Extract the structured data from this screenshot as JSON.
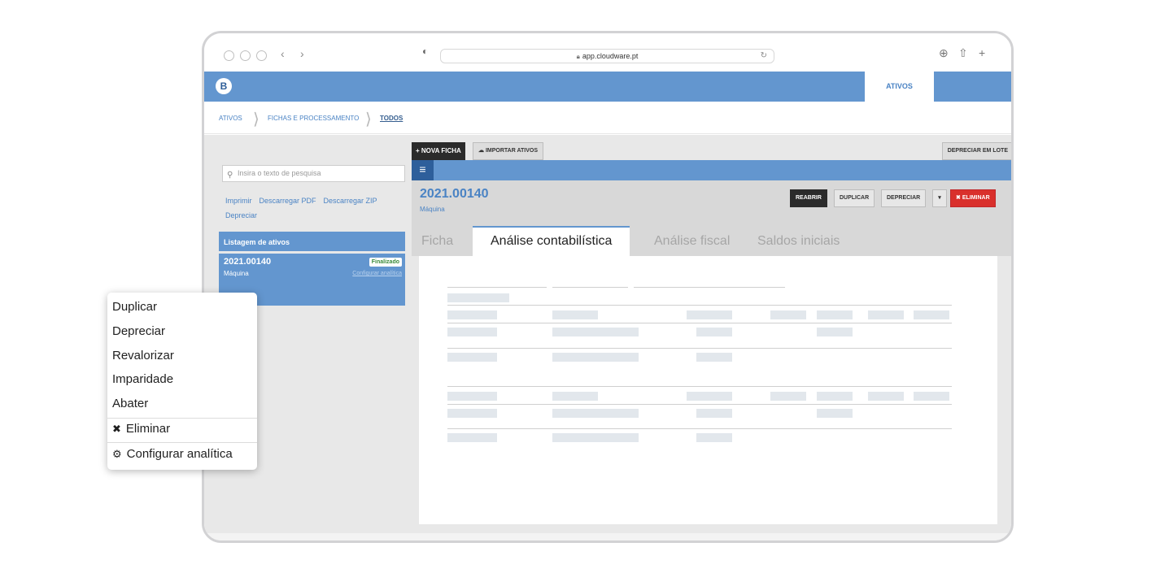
{
  "browser": {
    "url": "app.cloudware.pt"
  },
  "app": {
    "logo_letter": "B",
    "top_tab": "ATIVOS"
  },
  "breadcrumb": [
    "ATIVOS",
    "FICHAS E PROCESSAMENTO",
    "TODOS"
  ],
  "sidebar": {
    "search_placeholder": "Insira o texto de pesquisa",
    "links": [
      "Imprimir",
      "Descarregar PDF",
      "Descarregar ZIP",
      "Depreciar"
    ],
    "list_title": "Listagem de ativos",
    "item": {
      "code": "2021.00140",
      "type": "Máquina",
      "status": "Finalizado",
      "config_link": "Configurar analítica"
    }
  },
  "toolbar": {
    "new_record": "+ NOVA FICHA",
    "import": "IMPORTAR ATIVOS",
    "batch": "DEPRECIAR EM LOTE"
  },
  "record": {
    "code": "2021.00140",
    "type": "Máquina",
    "actions": {
      "reopen": "REABRIR",
      "duplicate": "DUPLICAR",
      "depreciate": "DEPRECIAR",
      "delete": "ELIMINAR"
    }
  },
  "tabs": [
    "Ficha",
    "Análise contabilística",
    "Análise fiscal",
    "Saldos iniciais"
  ],
  "selected_tab": "Análise contabilística",
  "context_menu": {
    "items": [
      "Duplicar",
      "Depreciar",
      "Revalorizar",
      "Imparidade",
      "Abater"
    ],
    "delete": "Eliminar",
    "configure": "Configurar analítica"
  },
  "colors": {
    "brand_blue": "#6396cf",
    "dark_button": "#2b2b2b",
    "danger": "#d9302c",
    "success": "#3a8b3a"
  }
}
